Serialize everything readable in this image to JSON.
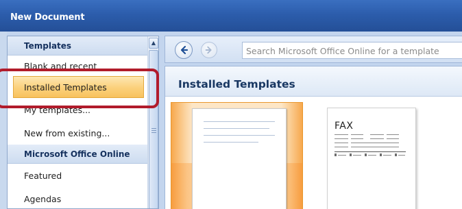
{
  "window": {
    "title": "New Document"
  },
  "sidebar": {
    "header": "Templates",
    "items": [
      {
        "label": "Blank and recent"
      },
      {
        "label": "Installed Templates",
        "selected": true
      },
      {
        "label": "My templates..."
      },
      {
        "label": "New from existing..."
      }
    ],
    "section2_header": "Microsoft Office Online",
    "items2": [
      {
        "label": "Featured"
      },
      {
        "label": "Agendas"
      }
    ]
  },
  "toolbar": {
    "back_icon": "back-arrow-icon",
    "forward_icon": "forward-arrow-icon",
    "search_placeholder": "Search Microsoft Office Online for a template"
  },
  "main": {
    "heading": "Installed Templates",
    "templates": [
      {
        "name": "blank-document",
        "selected": true
      },
      {
        "name": "fax",
        "caption": "FAX"
      }
    ]
  },
  "colors": {
    "titlebar": "#2c5dac",
    "selection": "#fbd07a",
    "annotation": "#b11b2b"
  }
}
